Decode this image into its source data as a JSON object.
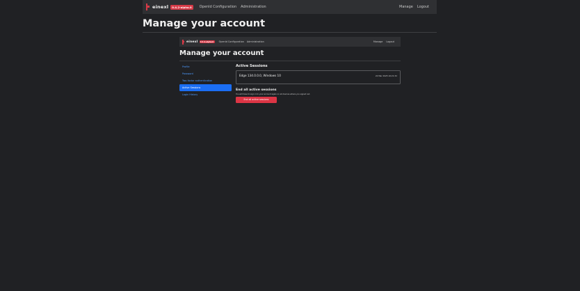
{
  "navbar": {
    "brand": "einexl",
    "version_badge": "0.4.2-alpha.0",
    "links_left": [
      "OpenId Configuration",
      "Administration"
    ],
    "links_right": [
      "Manage",
      "Logout"
    ]
  },
  "page": {
    "title": "Manage your account"
  },
  "inner": {
    "navbar": {
      "brand": "einexl",
      "version_badge": "0.4.2-alpha.0",
      "links_left": [
        "OpenId Configuration",
        "Administration"
      ],
      "links_right": [
        "Manage",
        "Logout"
      ]
    },
    "title": "Manage your account",
    "sidebar": {
      "items": [
        {
          "label": "Profile",
          "active": false
        },
        {
          "label": "Password",
          "active": false
        },
        {
          "label": "Two-factor authentication",
          "active": false
        },
        {
          "label": "Active Sessions",
          "active": true
        },
        {
          "label": "Login History",
          "active": false
        }
      ]
    },
    "sessions": {
      "heading": "Active Sessions",
      "items": [
        {
          "name": "Edge 134.0.0.0, Windows 10",
          "time": "22 Mar 2025 16:21:32"
        }
      ]
    },
    "end_all": {
      "heading": "End all active sessions",
      "description": "You will have to sign in to your account again on all devices where you signed out.",
      "button_label": "End all active sessions"
    }
  },
  "colors": {
    "accent": "#1b6ef3",
    "danger": "#dc3545",
    "brand": "#d63a47",
    "background": "#202124",
    "navbar": "#2f3033"
  }
}
